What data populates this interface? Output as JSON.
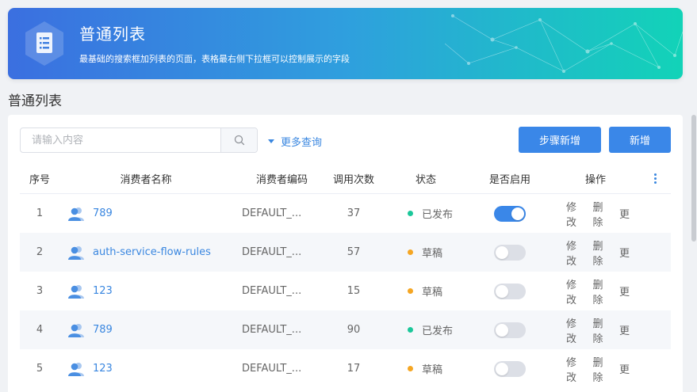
{
  "banner": {
    "title": "普通列表",
    "description": "最基础的搜索框加列表的页面，表格最右侧下拉框可以控制展示的字段",
    "logo_icon": "document-list-icon"
  },
  "page_title": "普通列表",
  "search": {
    "placeholder": "请输入内容",
    "value": "",
    "icon": "search-icon",
    "more_query_label": "更多查询"
  },
  "toolbar": {
    "step_add_label": "步骤新增",
    "add_label": "新增"
  },
  "table": {
    "headers": {
      "index": "序号",
      "name": "消费者名称",
      "code": "消费者编码",
      "calls": "调用次数",
      "status": "状态",
      "enabled": "是否启用",
      "actions": "操作"
    },
    "rows": [
      {
        "index": "1",
        "name": "789",
        "code": "DEFAULT_...",
        "calls": "37",
        "status": "已发布",
        "status_color": "#1bc79a",
        "enabled": true,
        "edit": "修改",
        "delete": "删除",
        "more": "更"
      },
      {
        "index": "2",
        "name": "auth-service-flow-rules",
        "code": "DEFAULT_...",
        "calls": "57",
        "status": "草稿",
        "status_color": "#f5a623",
        "enabled": false,
        "edit": "修改",
        "delete": "删除",
        "more": "更"
      },
      {
        "index": "3",
        "name": "123",
        "code": "DEFAULT_...",
        "calls": "15",
        "status": "草稿",
        "status_color": "#f5a623",
        "enabled": false,
        "edit": "修改",
        "delete": "删除",
        "more": "更"
      },
      {
        "index": "4",
        "name": "789",
        "code": "DEFAULT_...",
        "calls": "90",
        "status": "已发布",
        "status_color": "#1bc79a",
        "enabled": false,
        "edit": "修改",
        "delete": "删除",
        "more": "更"
      },
      {
        "index": "5",
        "name": "123",
        "code": "DEFAULT_...",
        "calls": "17",
        "status": "草稿",
        "status_color": "#f5a623",
        "enabled": false,
        "edit": "修改",
        "delete": "删除",
        "more": "更"
      }
    ]
  },
  "colors": {
    "primary": "#3a87e8",
    "published": "#1bc79a",
    "draft": "#f5a623"
  }
}
